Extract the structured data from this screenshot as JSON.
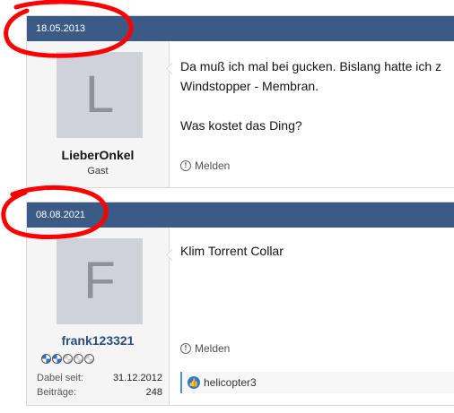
{
  "posts": [
    {
      "date": "18.05.2013",
      "avatar_letter": "L",
      "username": "LieberOnkel",
      "user_title": "Gast",
      "message": "Da muß ich mal bei gucken. Bislang hatte ich z\nWindstopper - Membran.\n\nWas kostet das Ding?",
      "report_label": "Melden"
    },
    {
      "date": "08.08.2021",
      "avatar_letter": "F",
      "username": "frank123321",
      "stats": {
        "joined_label": "Dabei seit:",
        "joined_value": "31.12.2012",
        "posts_label": "Beiträge:",
        "posts_value": "248"
      },
      "message": "Klim Torrent Collar",
      "report_label": "Melden",
      "reaction_user": "helicopter3"
    }
  ],
  "colors": {
    "header": "#3b5a86",
    "annotation": "#ff0000",
    "reaction": "#2d7ad6"
  },
  "icons": {
    "report": "warning-circle-icon",
    "reaction": "thumbs-up-icon",
    "badge": "bmw-logo-icon"
  }
}
